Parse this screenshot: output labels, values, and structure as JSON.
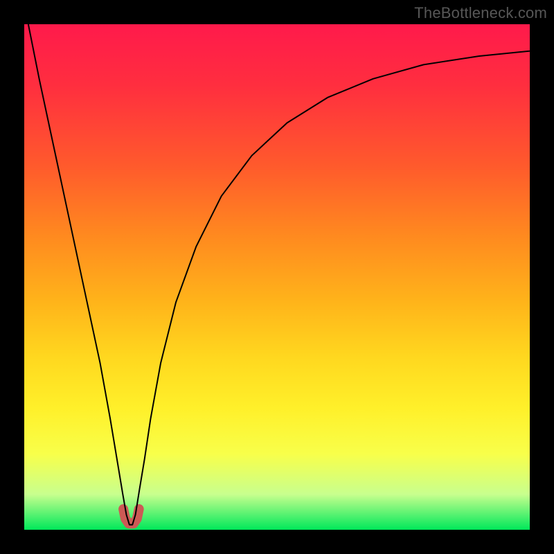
{
  "watermark": "TheBottleneck.com",
  "chart_data": {
    "type": "line",
    "title": "",
    "xlabel": "",
    "ylabel": "",
    "xlim": [
      0,
      100
    ],
    "ylim": [
      0,
      100
    ],
    "grid": false,
    "legend": null,
    "background_gradient_stops": [
      {
        "pos": 0,
        "color": "#ff1a4b"
      },
      {
        "pos": 12,
        "color": "#ff2e3f"
      },
      {
        "pos": 28,
        "color": "#ff5a2c"
      },
      {
        "pos": 42,
        "color": "#ff8a1f"
      },
      {
        "pos": 55,
        "color": "#ffb41a"
      },
      {
        "pos": 66,
        "color": "#ffd81f"
      },
      {
        "pos": 76,
        "color": "#fff02a"
      },
      {
        "pos": 85,
        "color": "#f8ff4a"
      },
      {
        "pos": 93,
        "color": "#c8ff8e"
      },
      {
        "pos": 100,
        "color": "#00e85a"
      }
    ],
    "series": [
      {
        "name": "bottleneck-curve",
        "color": "#000000",
        "stroke_width": 2,
        "x": [
          0.8,
          3,
          6,
          9,
          12,
          15,
          17,
          18.5,
          19.5,
          20.2,
          20.8,
          21.4,
          22.0,
          22.8,
          23.8,
          25,
          27,
          30,
          34,
          39,
          45,
          52,
          60,
          69,
          79,
          90,
          100
        ],
        "y": [
          100,
          89,
          75,
          61,
          47,
          33,
          22,
          13,
          7,
          3,
          1,
          1,
          3,
          8,
          14,
          22,
          33,
          45,
          56,
          66,
          74,
          80.5,
          85.5,
          89.2,
          92,
          93.7,
          94.7
        ]
      }
    ],
    "marker": {
      "name": "trough-marker",
      "color": "#cc5a55",
      "cap": "round",
      "stroke_width": 14,
      "points_xy": [
        [
          19.6,
          4.1
        ],
        [
          20.0,
          2.2
        ],
        [
          20.7,
          1.2
        ],
        [
          21.6,
          1.2
        ],
        [
          22.3,
          2.2
        ],
        [
          22.7,
          4.1
        ]
      ]
    }
  }
}
